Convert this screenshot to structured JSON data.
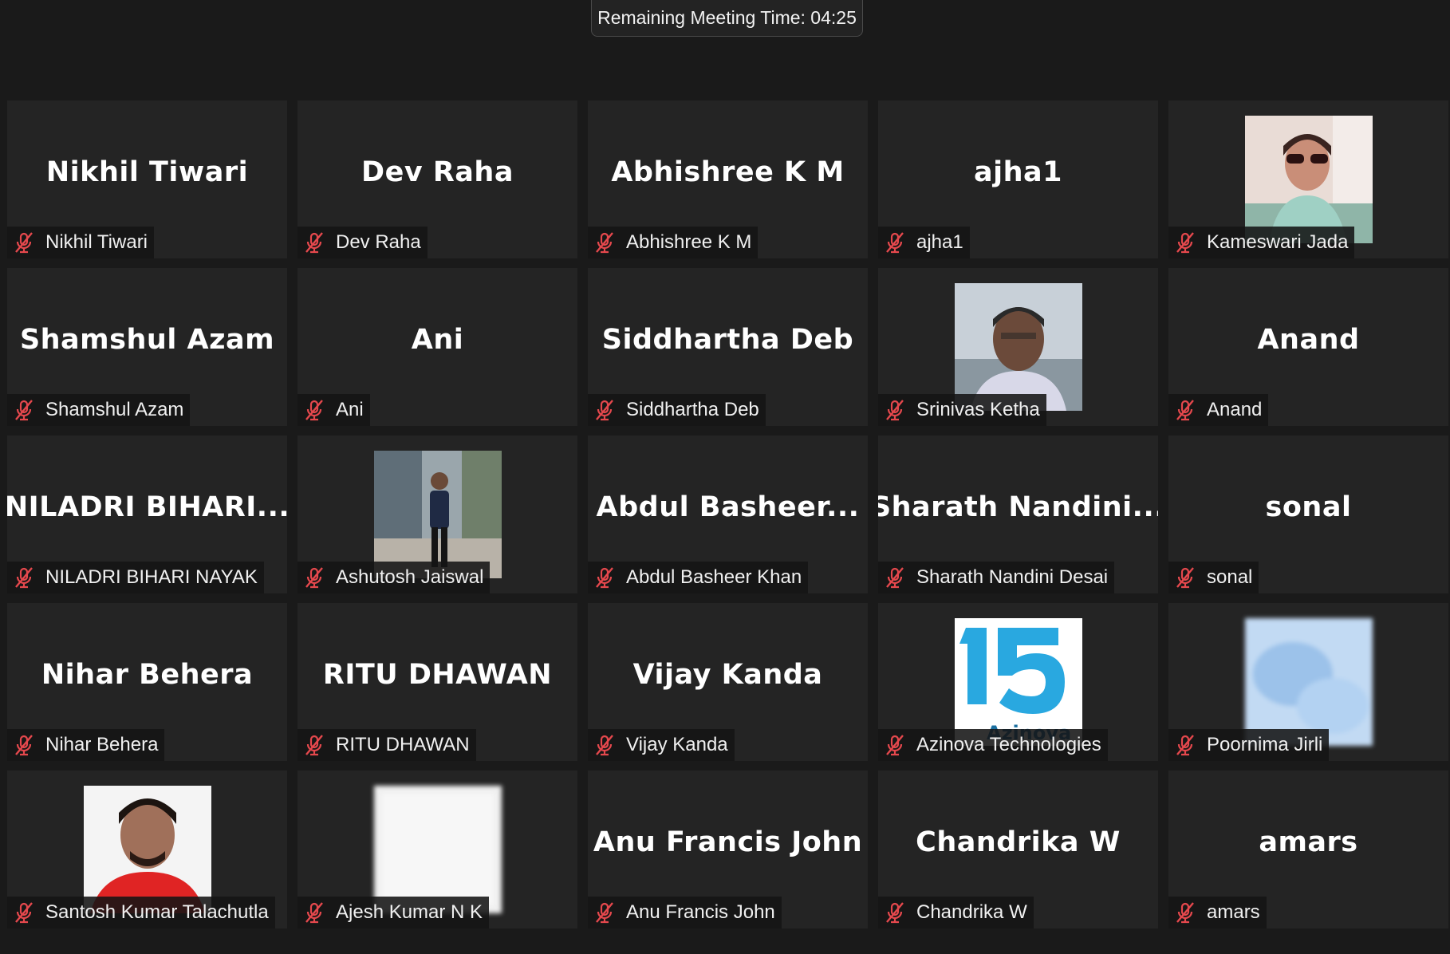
{
  "meeting": {
    "remaining_time_label": "Remaining Meeting Time: 04:25"
  },
  "colors": {
    "background": "#1a1a1a",
    "tile": "#242424",
    "muted_icon": "#e5484d"
  },
  "participants": [
    {
      "display": "Nikhil Tiwari",
      "name": "Nikhil Tiwari",
      "muted": true
    },
    {
      "display": "Dev Raha",
      "name": "Dev Raha",
      "muted": true
    },
    {
      "display": "Abhishree K M",
      "name": "Abhishree K M",
      "muted": true
    },
    {
      "display": "ajha1",
      "name": "ajha1",
      "muted": true
    },
    {
      "name": "Kameswari Jada",
      "muted": true,
      "avatar": "photo-woman-sunglasses"
    },
    {
      "display": "Shamshul Azam",
      "name": "Shamshul Azam",
      "muted": true
    },
    {
      "display": "Ani",
      "name": "Ani",
      "muted": true
    },
    {
      "display": "Siddhartha Deb",
      "name": "Siddhartha Deb",
      "muted": true
    },
    {
      "name": "Srinivas Ketha",
      "muted": true,
      "avatar": "photo-man-outdoor"
    },
    {
      "display": "Anand",
      "name": "Anand",
      "muted": true
    },
    {
      "display": "NILADRI  BIHARI...",
      "name": "NILADRI BIHARI NAYAK",
      "muted": true
    },
    {
      "name": "Ashutosh Jaiswal",
      "muted": true,
      "avatar": "photo-man-street"
    },
    {
      "display": "Abdul  Basheer...",
      "name": "Abdul Basheer Khan",
      "muted": true
    },
    {
      "display": "Sharath  Nandini...",
      "name": "Sharath Nandini Desai",
      "muted": true
    },
    {
      "display": "sonal",
      "name": "sonal",
      "muted": true
    },
    {
      "display": "Nihar Behera",
      "name": "Nihar Behera",
      "muted": true
    },
    {
      "display": "RITU DHAWAN",
      "name": "RITU DHAWAN",
      "muted": true
    },
    {
      "display": "Vijay Kanda",
      "name": "Vijay Kanda",
      "muted": true
    },
    {
      "name": "Azinova Technologies",
      "muted": true,
      "avatar": "logo-15-years"
    },
    {
      "name": "Poornima Jirli",
      "muted": true,
      "avatar": "blurred-blue"
    },
    {
      "name": "Santosh Kumar Talachutla",
      "muted": true,
      "avatar": "photo-man-red-shirt"
    },
    {
      "name": "Ajesh Kumar N K",
      "muted": true,
      "avatar": "blurred-white"
    },
    {
      "display": "Anu Francis John",
      "name": "Anu Francis John",
      "muted": true
    },
    {
      "display": "Chandrika W",
      "name": "Chandrika W",
      "muted": true
    },
    {
      "display": "amars",
      "name": "amars",
      "muted": true
    }
  ]
}
